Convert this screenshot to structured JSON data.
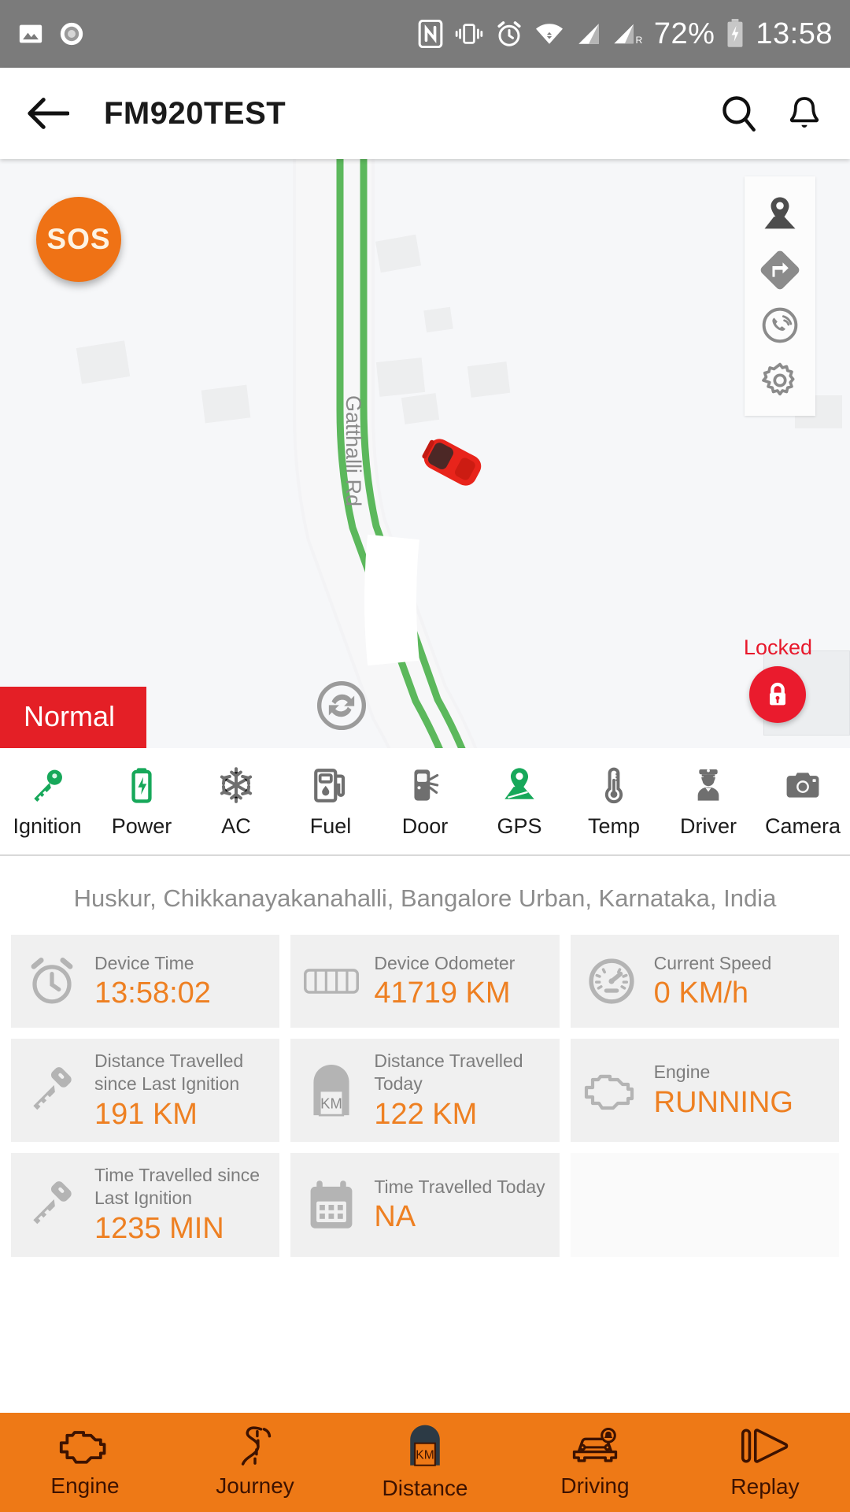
{
  "statusbar": {
    "icons_left": [
      "image-icon",
      "record-icon"
    ],
    "icons_right": [
      "nfc-icon",
      "vibrate-icon",
      "alarm-icon",
      "wifi-icon",
      "signal-icon",
      "signal-roaming-icon"
    ],
    "battery_percent": "72%",
    "battery_icon": "battery-charging-icon",
    "time": "13:58"
  },
  "appbar": {
    "back_icon": "back-arrow-icon",
    "title": "FM920TEST",
    "search_icon": "search-icon",
    "notification_icon": "bell-icon"
  },
  "map": {
    "sos_label": "SOS",
    "road_label": "Gatthalli Rd",
    "vehicle_marker": "red-car-icon",
    "refresh_icon": "refresh-icon",
    "controls": [
      {
        "name": "map-pin-icon",
        "label": "Map"
      },
      {
        "name": "directions-icon",
        "label": "Directions"
      },
      {
        "name": "call-icon",
        "label": "Call"
      },
      {
        "name": "settings-gear-icon",
        "label": "Settings"
      }
    ],
    "lock": {
      "label": "Locked",
      "icon": "lock-closed-icon",
      "color": "#ea1b2d"
    },
    "status_badge": {
      "label": "Normal",
      "color": "#e41f26"
    }
  },
  "status_strip": [
    {
      "label": "Ignition",
      "icon": "key-icon",
      "color": "#17a85a",
      "active": true
    },
    {
      "label": "Power",
      "icon": "battery-bolt-icon",
      "color": "#17a85a",
      "active": true
    },
    {
      "label": "AC",
      "icon": "snowflake-icon",
      "color": "#6f6f6f",
      "active": false
    },
    {
      "label": "Fuel",
      "icon": "fuel-pump-icon",
      "color": "#6f6f6f",
      "active": false
    },
    {
      "label": "Door",
      "icon": "car-door-icon",
      "color": "#6f6f6f",
      "active": false
    },
    {
      "label": "GPS",
      "icon": "gps-pin-icon",
      "color": "#17a85a",
      "active": true
    },
    {
      "label": "Temp",
      "icon": "thermometer-icon",
      "color": "#6f6f6f",
      "active": false
    },
    {
      "label": "Driver",
      "icon": "driver-icon",
      "color": "#6f6f6f",
      "active": false
    },
    {
      "label": "Camera",
      "icon": "camera-icon",
      "color": "#6f6f6f",
      "active": false
    }
  ],
  "address": "Huskur, Chikkanayakanahalli, Bangalore Urban, Karnataka, India",
  "cards": [
    {
      "icon": "alarm-clock-icon",
      "label": "Device Time",
      "value": "13:58:02"
    },
    {
      "icon": "odometer-bar-icon",
      "label": "Device Odometer",
      "value": "41719 KM"
    },
    {
      "icon": "speedometer-icon",
      "label": "Current Speed",
      "value": "0 KM/h"
    },
    {
      "icon": "key-icon",
      "label": "Distance Travelled since Last Ignition",
      "value": "191 KM"
    },
    {
      "icon": "km-marker-icon",
      "label": "Distance Travelled Today",
      "value": "122 KM"
    },
    {
      "icon": "engine-icon",
      "label": "Engine",
      "value": "RUNNING"
    },
    {
      "icon": "key-icon",
      "label": "Time Travelled since Last Ignition",
      "value": "1235 MIN"
    },
    {
      "icon": "calendar-icon",
      "label": "Time Travelled Today",
      "value": "NA"
    },
    {
      "icon": "",
      "label": "",
      "value": ""
    }
  ],
  "bottom_nav": [
    {
      "label": "Engine",
      "icon": "engine-icon"
    },
    {
      "label": "Journey",
      "icon": "road-icon"
    },
    {
      "label": "Distance",
      "icon": "km-marker-icon"
    },
    {
      "label": "Driving",
      "icon": "car-alert-icon"
    },
    {
      "label": "Replay",
      "icon": "replay-icon"
    }
  ],
  "colors": {
    "accent_orange": "#ee7916",
    "value_orange": "#ee8022",
    "alert_red": "#e41f26",
    "active_green": "#17a85a",
    "statusbar_gray": "#7b7b7b"
  }
}
